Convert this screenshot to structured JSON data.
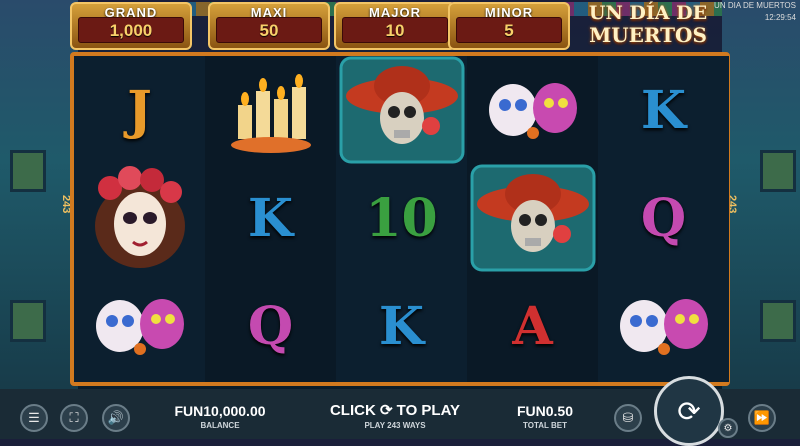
{
  "jackpots": [
    {
      "label": "GRAND",
      "value": "1,000"
    },
    {
      "label": "MAXI",
      "value": "50"
    },
    {
      "label": "MAJOR",
      "value": "10"
    },
    {
      "label": "MINOR",
      "value": "5"
    }
  ],
  "game": {
    "logo_line1": "UN DÍA DE",
    "logo_line2": "MUERTOS",
    "window_title": "UN DIA DE MUERTOS",
    "clock": "12:29:54",
    "ways_side": "243"
  },
  "reels": [
    [
      "J",
      "candles",
      "catrina-woman"
    ],
    [
      "K",
      "candles",
      "Q"
    ],
    [
      "skull-sombrero",
      "10",
      "K"
    ],
    [
      "sugar-skulls",
      "skull-sombrero",
      "A"
    ],
    [
      "K",
      "Q",
      "sugar-skulls"
    ]
  ],
  "reel_grid": [
    [
      "J",
      "catrina-woman",
      "sugar-skulls"
    ],
    [
      "candles",
      "K",
      "Q"
    ],
    [
      "skull-sombrero",
      "10",
      "K"
    ],
    [
      "sugar-skulls",
      "skull-sombrero",
      "A"
    ],
    [
      "K",
      "Q",
      "sugar-skulls"
    ]
  ],
  "bottom": {
    "balance_value": "FUN10,000.00",
    "balance_label": "BALANCE",
    "click_to_play": "CLICK ⟳ TO PLAY",
    "play_ways": "PLAY 243 WAYS",
    "bet_value": "FUN0.50",
    "bet_label": "TOTAL BET"
  },
  "colors": {
    "frame": "#d27a1f",
    "letter_blue": "#2a8fd0",
    "letter_orange": "#e89a2a",
    "letter_pink": "#c44ab0",
    "letter_red": "#d03030"
  }
}
